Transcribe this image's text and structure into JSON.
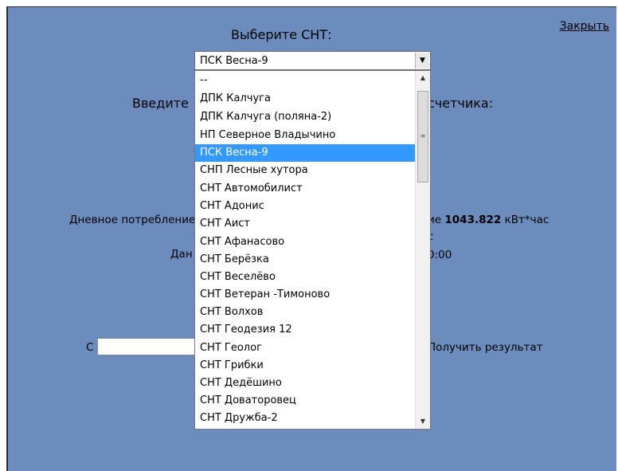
{
  "close_link": "Закрыть",
  "select_title": "Выберите СНТ:",
  "select": {
    "selected_value": "ПСК Весна-9",
    "options": [
      "--",
      "ДПК Калчуга",
      "ДПК Калчуга (поляна-2)",
      "НП Северное Владычино",
      "ПСК Весна-9",
      "СНП Лесные хутора",
      "СНТ Автомобилист",
      "СНТ Адонис",
      "СНТ Аист",
      "СНТ Афанасово",
      "СНТ Берёзка",
      "СНТ Веселёво",
      "СНТ Ветеран -Тимоново",
      "СНТ Волхов",
      "СНТ Геодезия 12",
      "СНТ Геолог",
      "СНТ Грибки",
      "СНТ Дедёшино",
      "СНТ Доваторовец",
      "СНТ Дружба-2"
    ]
  },
  "enter_label_left": "Введите",
  "enter_label_right": "счетчика:",
  "consumption": {
    "left": "Дневное потребление",
    "right_prefix": "ие",
    "right_value": "1043.822",
    "right_unit": "кВт*час"
  },
  "fragments": {
    "f1_left": "*",
    "f1_right": "с",
    "f2_left": "Дан",
    "f2_right": "0:00"
  },
  "from_label": "С",
  "from_input_value": "",
  "result_button": "Получить результат"
}
